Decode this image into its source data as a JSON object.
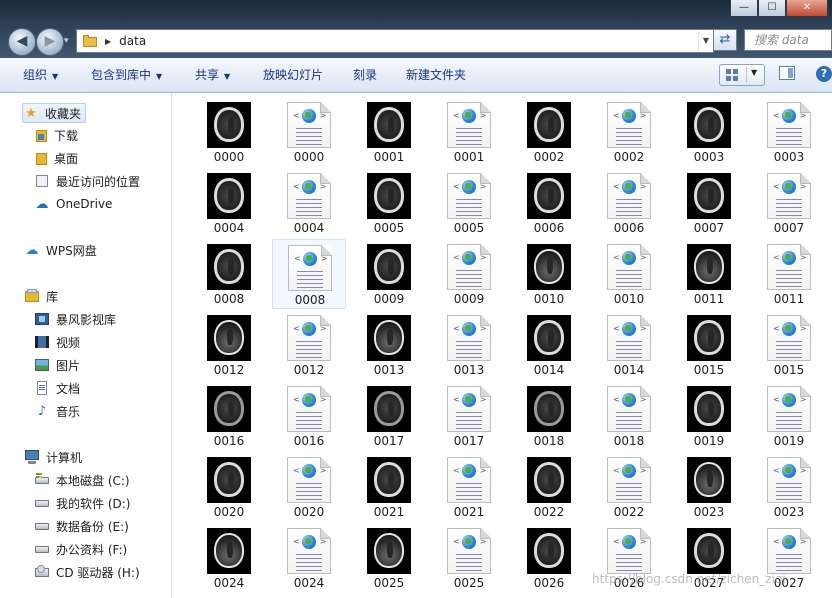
{
  "window": {
    "controls": [
      "—",
      "☐",
      "✕"
    ]
  },
  "address_bar": {
    "path": "data",
    "search_placeholder": "搜索 data"
  },
  "toolbar": {
    "organize": "组织",
    "include_in_library": "包含到库中",
    "share": "共享",
    "slideshow": "放映幻灯片",
    "burn": "刻录",
    "new_folder": "新建文件夹"
  },
  "nav": {
    "favorites": "收藏夹",
    "downloads": "下载",
    "desktop": "桌面",
    "recent_places": "最近访问的位置",
    "onedrive": "OneDrive",
    "wps_drive": "WPS网盘",
    "libraries": "库",
    "storm_video": "暴风影视库",
    "videos": "视频",
    "pictures": "图片",
    "documents": "文档",
    "music": "音乐",
    "computer": "计算机",
    "drive_c": "本地磁盘 (C:)",
    "drive_d": "我的软件 (D:)",
    "drive_e": "数据备份 (E:)",
    "drive_f": "办公资料 (F:)",
    "drive_h": "CD 驱动器 (H:)"
  },
  "files": [
    {
      "name": "0000",
      "kind": "ct"
    },
    {
      "name": "0000",
      "kind": "html"
    },
    {
      "name": "0001",
      "kind": "ct"
    },
    {
      "name": "0001",
      "kind": "html"
    },
    {
      "name": "0002",
      "kind": "ct"
    },
    {
      "name": "0002",
      "kind": "html"
    },
    {
      "name": "0003",
      "kind": "ct"
    },
    {
      "name": "0003",
      "kind": "html"
    },
    {
      "name": "0004",
      "kind": "ct"
    },
    {
      "name": "0004",
      "kind": "html"
    },
    {
      "name": "0005",
      "kind": "ct"
    },
    {
      "name": "0005",
      "kind": "html"
    },
    {
      "name": "0006",
      "kind": "ct"
    },
    {
      "name": "0006",
      "kind": "html"
    },
    {
      "name": "0007",
      "kind": "ct"
    },
    {
      "name": "0007",
      "kind": "html"
    },
    {
      "name": "0008",
      "kind": "ct"
    },
    {
      "name": "0008",
      "kind": "html",
      "selected": true
    },
    {
      "name": "0009",
      "kind": "ct"
    },
    {
      "name": "0009",
      "kind": "html"
    },
    {
      "name": "0010",
      "kind": "ct",
      "variant": "base"
    },
    {
      "name": "0010",
      "kind": "html"
    },
    {
      "name": "0011",
      "kind": "ct",
      "variant": "base"
    },
    {
      "name": "0011",
      "kind": "html"
    },
    {
      "name": "0012",
      "kind": "ct",
      "variant": "base"
    },
    {
      "name": "0012",
      "kind": "html"
    },
    {
      "name": "0013",
      "kind": "ct",
      "variant": "base"
    },
    {
      "name": "0013",
      "kind": "html"
    },
    {
      "name": "0014",
      "kind": "ct"
    },
    {
      "name": "0014",
      "kind": "html"
    },
    {
      "name": "0015",
      "kind": "ct"
    },
    {
      "name": "0015",
      "kind": "html"
    },
    {
      "name": "0016",
      "kind": "ct",
      "variant": "dim"
    },
    {
      "name": "0016",
      "kind": "html"
    },
    {
      "name": "0017",
      "kind": "ct",
      "variant": "dim"
    },
    {
      "name": "0017",
      "kind": "html"
    },
    {
      "name": "0018",
      "kind": "ct",
      "variant": "dim"
    },
    {
      "name": "0018",
      "kind": "html"
    },
    {
      "name": "0019",
      "kind": "ct"
    },
    {
      "name": "0019",
      "kind": "html"
    },
    {
      "name": "0020",
      "kind": "ct"
    },
    {
      "name": "0020",
      "kind": "html"
    },
    {
      "name": "0021",
      "kind": "ct"
    },
    {
      "name": "0021",
      "kind": "html"
    },
    {
      "name": "0022",
      "kind": "ct"
    },
    {
      "name": "0022",
      "kind": "html"
    },
    {
      "name": "0023",
      "kind": "ct",
      "variant": "base"
    },
    {
      "name": "0023",
      "kind": "html"
    },
    {
      "name": "0024",
      "kind": "ct",
      "variant": "base"
    },
    {
      "name": "0024",
      "kind": "html"
    },
    {
      "name": "0025",
      "kind": "ct",
      "variant": "base"
    },
    {
      "name": "0025",
      "kind": "html"
    },
    {
      "name": "0026",
      "kind": "ct"
    },
    {
      "name": "0026",
      "kind": "html"
    },
    {
      "name": "0027",
      "kind": "ct"
    },
    {
      "name": "0027",
      "kind": "html"
    }
  ],
  "watermark": "https://blog.csdn.net/zichen_ziqi"
}
